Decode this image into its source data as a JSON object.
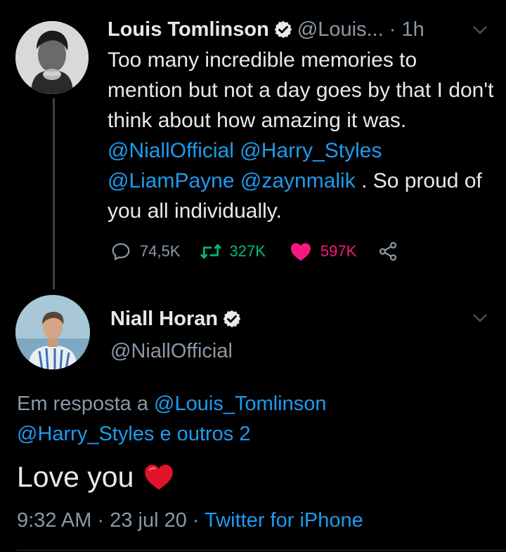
{
  "tweet1": {
    "name": "Louis Tomlinson",
    "handle": "@Louis...",
    "time": "· 1h",
    "text": {
      "intro": "Too many incredible memories to mention but not a day goes by that I don't think about how amazing it was.",
      "mentions": [
        "@NiallOfficial",
        "@Harry_Styles",
        "@LiamPayne",
        "@zaynmalik"
      ],
      "outro": ". So proud of you all individually."
    },
    "actions": {
      "replies": "74,5K",
      "retweets": "327K",
      "likes": "597K"
    }
  },
  "tweet2": {
    "name": "Niall Horan",
    "handle": "@NiallOfficial",
    "reply_to": {
      "prefix": "Em resposta a",
      "user1": "@Louis_Tomlinson",
      "user2": "@Harry_Styles",
      "suffix": "e outros 2"
    },
    "text": "Love you",
    "emoji": "heart",
    "time": "9:32 AM",
    "date": "23 jul 20",
    "source": "Twitter for iPhone"
  },
  "colors": {
    "background": "#000000",
    "text": "#e7e9ea",
    "muted": "#8b98a5",
    "link": "#1d9bf0",
    "retweet": "#00ba7c",
    "like": "#f91880"
  },
  "icons": {
    "verified": "verified-badge-icon",
    "chevron": "chevron-down-icon",
    "reply": "reply-icon",
    "retweet": "retweet-icon",
    "like": "heart-filled-icon",
    "share": "share-icon"
  }
}
